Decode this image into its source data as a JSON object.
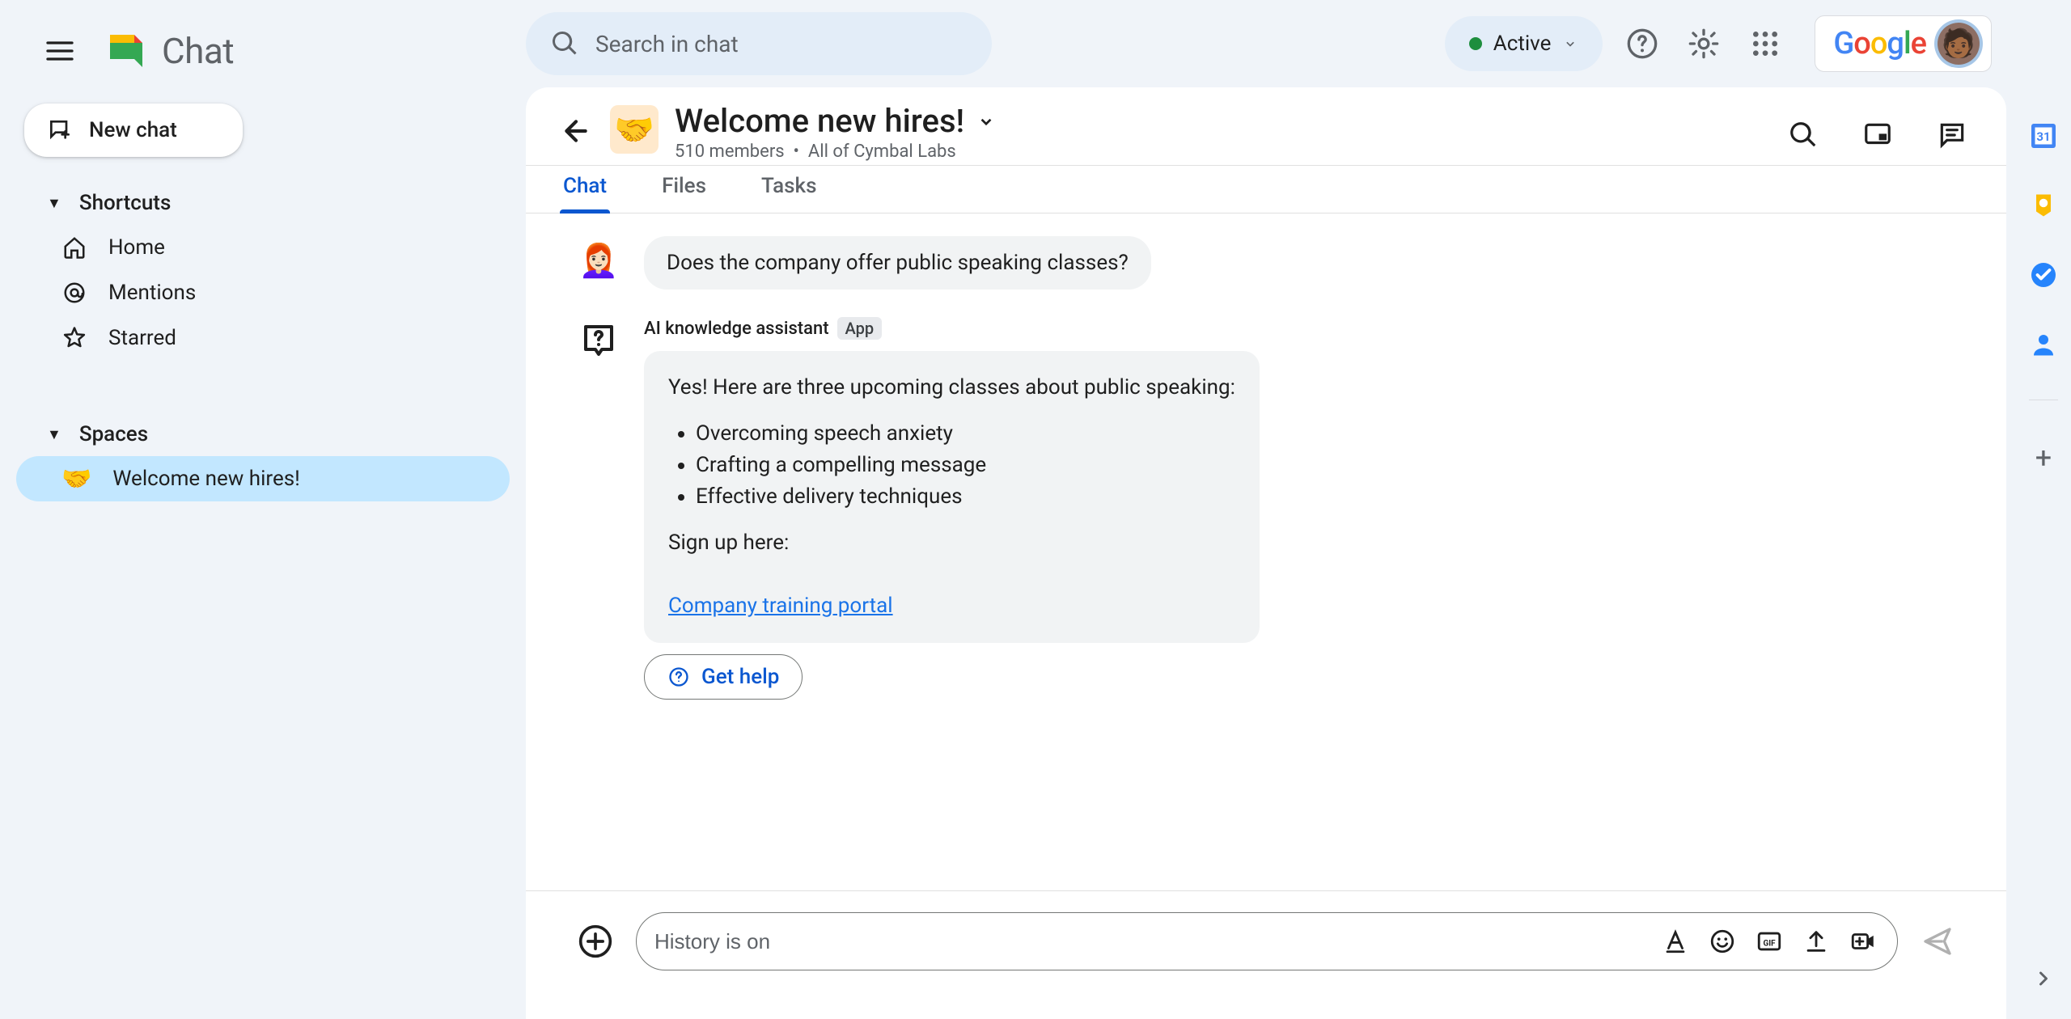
{
  "app_name": "Chat",
  "search_placeholder": "Search in chat",
  "status_label": "Active",
  "new_chat_label": "New chat",
  "sidebar": {
    "shortcuts_heading": "Shortcuts",
    "home": "Home",
    "mentions": "Mentions",
    "starred": "Starred",
    "spaces_heading": "Spaces",
    "space_item": "Welcome new hires!"
  },
  "space": {
    "title": "Welcome new hires!",
    "members_text": "510 members",
    "org_text": "All of Cymbal Labs"
  },
  "tabs": {
    "chat": "Chat",
    "files": "Files",
    "tasks": "Tasks"
  },
  "messages": {
    "user_question": "Does the company offer public speaking classes?",
    "bot_name": "AI knowledge assistant",
    "bot_badge": "App",
    "bot_intro": "Yes! Here are three upcoming classes about public speaking:",
    "bot_items": {
      "0": "Overcoming speech anxiety",
      "1": "Crafting a compelling message",
      "2": "Effective delivery techniques"
    },
    "bot_signup": "Sign up here:",
    "bot_link": "Company training portal",
    "get_help_label": "Get help"
  },
  "composer_placeholder": "History is on",
  "google_brand": "Google"
}
